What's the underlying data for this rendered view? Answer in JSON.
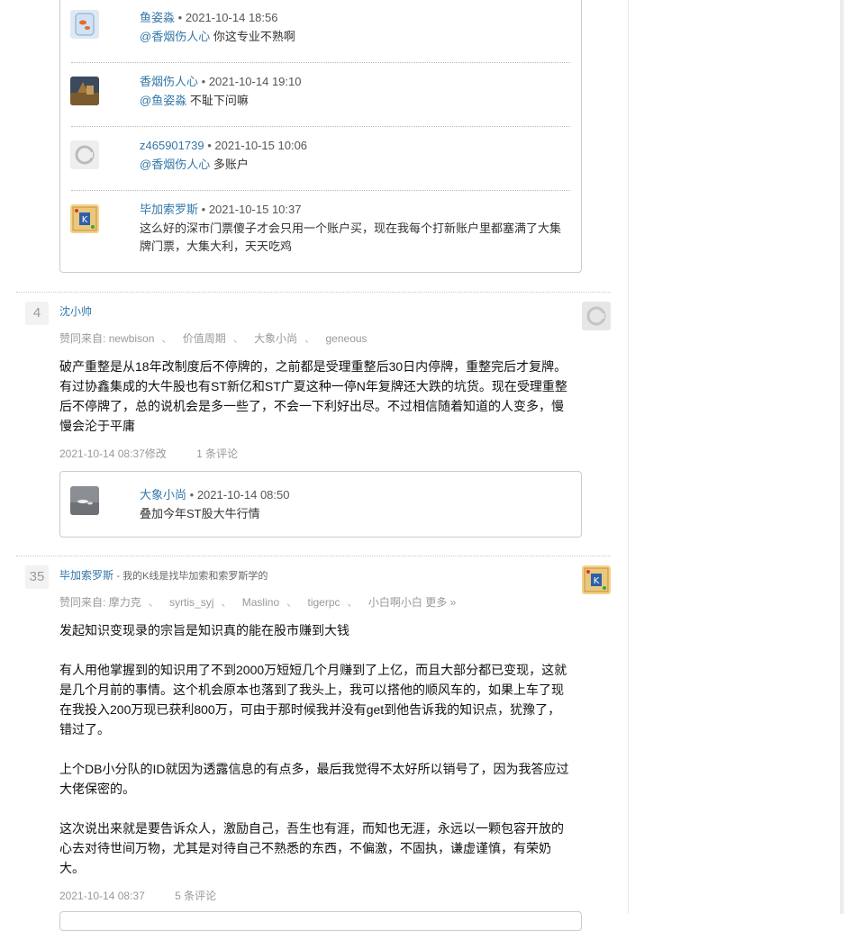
{
  "thread_top": {
    "comments": [
      {
        "author": "鱼姿淼",
        "time": "2021-10-14 18:56",
        "mention": "@香烟伤人心",
        "text": "你这专业不熟啊",
        "avatar_icon": "fishbowl-avatar-icon"
      },
      {
        "author": "香烟伤人心",
        "time": "2021-10-14 19:10",
        "mention": "@鱼姿淼",
        "text": "不耻下问嘛",
        "avatar_icon": "photo-avatar-icon"
      },
      {
        "author": "z465901739",
        "time": "2021-10-15 10:06",
        "mention": "@香烟伤人心",
        "text": "多账户",
        "avatar_icon": "default-avatar-icon"
      },
      {
        "author": "毕加索罗斯",
        "time": "2021-10-15 10:37",
        "mention": "",
        "text": "这么好的深市门票傻子才会只用一个账户买，现在我每个打新账户里都塞满了大集牌门票，大集大利，天天吃鸡",
        "avatar_icon": "k-badge-avatar-icon"
      }
    ]
  },
  "answers": [
    {
      "votes": "4",
      "author": "沈小帅",
      "signature": "",
      "likes_label": "赞同来自:",
      "likers": [
        "newbison",
        "价值周期",
        "大象小尚",
        "geneous"
      ],
      "more": "",
      "paragraphs": [
        "破产重整是从18年改制度后不停牌的，之前都是受理重整后30日内停牌，重整完后才复牌。有过协鑫集成的大牛股也有ST新亿和ST广夏这种一停N年复牌还大跌的坑货。现在受理重整后不停牌了，总的说机会是多一些了，不会一下利好出尽。不过相信随着知道的人变多，慢慢会沦于平庸"
      ],
      "date": "2021-10-14 08:37修改",
      "comment_count": "1 条评论",
      "sub_comments": [
        {
          "author": "大象小尚",
          "time": "2021-10-14 08:50",
          "text": "叠加今年ST股大牛行情",
          "avatar_icon": "grey-photo-avatar-icon"
        }
      ]
    },
    {
      "votes": "35",
      "author": "毕加索罗斯",
      "signature": "我的K线是找毕加索和索罗斯学的",
      "likes_label": "赞同来自:",
      "likers": [
        "摩力克",
        "syrtis_syj",
        "Maslino",
        "tigerpc",
        "小白啊小白"
      ],
      "more": "更多 »",
      "paragraphs": [
        "发起知识变现录的宗旨是知识真的能在股市赚到大钱",
        "有人用他掌握到的知识用了不到2000万短短几个月赚到了上亿，而且大部分都已变现，这就是几个月前的事情。这个机会原本也落到了我头上，我可以搭他的顺风车的，如果上车了现在我投入200万现已获利800万，可由于那时候我并没有get到他告诉我的知识点，犹豫了，错过了。",
        "上个DB小分队的ID就因为透露信息的有点多，最后我觉得不太好所以销号了，因为我答应过大佬保密的。",
        "这次说出来就是要告诉众人，激励自己，吾生也有涯，而知也无涯，永远以一颗包容开放的心去对待世间万物，尤其是对待自己不熟悉的东西，不偏激，不固执，谦虚谨慎，有荣奶大。"
      ],
      "date": "2021-10-14 08:37",
      "comment_count": "5 条评论"
    }
  ],
  "colors": {
    "link": "#3377aa",
    "muted": "#999999",
    "border": "#cccccc"
  }
}
